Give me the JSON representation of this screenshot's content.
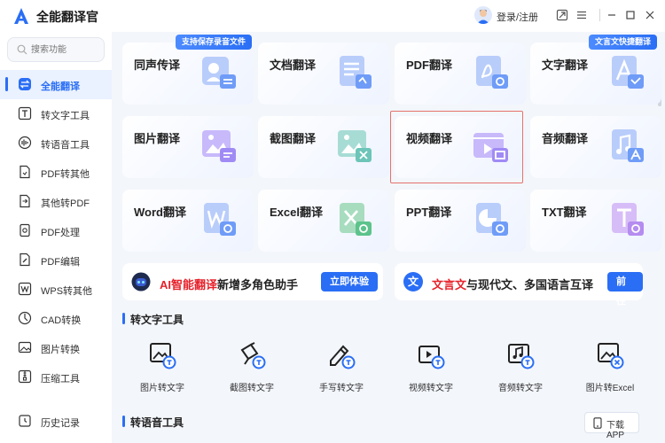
{
  "app": {
    "title": "全能翻译官",
    "login": "登录/注册",
    "colors": {
      "accent": "#2a6ef5",
      "highlight": "#e6212a"
    }
  },
  "search": {
    "placeholder": "搜索功能"
  },
  "sidebar": {
    "items": [
      {
        "label": "全能翻译",
        "icon": "translate-icon",
        "active": true
      },
      {
        "label": "转文字工具",
        "icon": "text-tool-icon"
      },
      {
        "label": "转语音工具",
        "icon": "voice-tool-icon"
      },
      {
        "label": "PDF转其他",
        "icon": "pdf-convert-icon"
      },
      {
        "label": "其他转PDF",
        "icon": "to-pdf-icon"
      },
      {
        "label": "PDF处理",
        "icon": "pdf-process-icon"
      },
      {
        "label": "PDF编辑",
        "icon": "pdf-edit-icon"
      },
      {
        "label": "WPS转其他",
        "icon": "wps-icon"
      },
      {
        "label": "CAD转换",
        "icon": "cad-icon"
      },
      {
        "label": "图片转换",
        "icon": "image-icon"
      },
      {
        "label": "压缩工具",
        "icon": "compress-icon"
      },
      {
        "label": "历史记录",
        "icon": "history-icon"
      }
    ]
  },
  "cards": [
    {
      "label": "同声传译",
      "tag": "支持保存录音文件",
      "icon": "simultaneous-icon"
    },
    {
      "label": "文档翻译",
      "icon": "document-icon"
    },
    {
      "label": "PDF翻译",
      "icon": "pdf-icon"
    },
    {
      "label": "文字翻译",
      "tag": "文言文快捷翻译",
      "icon": "text-icon"
    },
    {
      "label": "图片翻译",
      "icon": "picture-icon"
    },
    {
      "label": "截图翻译",
      "icon": "screenshot-icon"
    },
    {
      "label": "视频翻译",
      "icon": "video-icon"
    },
    {
      "label": "音频翻译",
      "icon": "audio-icon"
    },
    {
      "label": "Word翻译",
      "icon": "word-icon"
    },
    {
      "label": "Excel翻译",
      "icon": "excel-icon"
    },
    {
      "label": "PPT翻译",
      "icon": "ppt-icon"
    },
    {
      "label": "TXT翻译",
      "icon": "txt-icon"
    }
  ],
  "banners": [
    {
      "prefix": "AI智能翻译",
      "text": "新增多角色助手",
      "button": "立即体验",
      "icon": "robot-icon"
    },
    {
      "prefix": "文言文",
      "text": "与现代文、多国语言互译",
      "button": "前往",
      "icon": "wen-icon",
      "badge": "文"
    }
  ],
  "sections": {
    "text_tools": "转文字工具",
    "voice_tools": "转语音工具"
  },
  "tools": [
    {
      "label": "图片转文字",
      "icon": "image-to-text-icon"
    },
    {
      "label": "截图转文字",
      "icon": "screenshot-to-text-icon"
    },
    {
      "label": "手写转文字",
      "icon": "handwriting-to-text-icon"
    },
    {
      "label": "视频转文字",
      "icon": "video-to-text-icon"
    },
    {
      "label": "音频转文字",
      "icon": "audio-to-text-icon"
    },
    {
      "label": "图片转Excel",
      "icon": "image-to-excel-icon"
    }
  ],
  "download": {
    "label": "下载APP"
  }
}
